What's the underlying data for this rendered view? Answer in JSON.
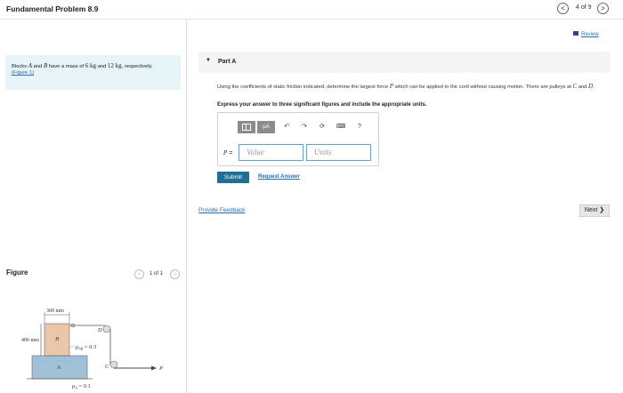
{
  "header": {
    "title": "Fundamental Problem 8.9",
    "page_count": "4 of 9",
    "prev_glyph": "<",
    "next_glyph": ">"
  },
  "problem": {
    "text_1": "Blocks ",
    "var_A": "A",
    "text_2": " and ",
    "var_B": "B",
    "text_3": " have a mass of ",
    "mass_A": "6 kg",
    "text_4": " and ",
    "mass_B": "12 kg",
    "text_5": ", respectively.",
    "figure_link": "(Figure 1)"
  },
  "figure_panel": {
    "title": "Figure",
    "count": "1 of 1",
    "prev_glyph": "<",
    "next_glyph": ">",
    "labels": {
      "width": "300 mm",
      "height": "400 mm",
      "block_A": "A",
      "block_B": "B",
      "pulley_C": "C",
      "pulley_D": "D",
      "force_P": "P",
      "mu_AB": "μ",
      "mu_AB_sub": "AB",
      "mu_AB_val": " = 0.3",
      "mu_A": "μ",
      "mu_A_sub": "A",
      "mu_A_val": " = 0.1"
    }
  },
  "review": {
    "label": "Review"
  },
  "part": {
    "caret": "▼",
    "title": "Part A",
    "question_1": "Using the coefficients of static friction indicated, determine the largest force ",
    "question_var": "P",
    "question_2": " which can be applied to the cord without causing motion. There are pulleys at ",
    "question_C": "C",
    "question_3": " and ",
    "question_D": "D",
    "question_4": ".",
    "instructions": "Express your answer to three significant figures and include the appropriate units."
  },
  "answer": {
    "toolbar": {
      "mu_label": "μA",
      "undo": "↶",
      "redo": "↷",
      "reset": "⟳",
      "keyboard": "⌨",
      "help": "?"
    },
    "variable": "P",
    "equals": " =",
    "value_placeholder": "Value",
    "units_placeholder": "Units"
  },
  "actions": {
    "submit": "Submit",
    "request_answer": "Request Answer",
    "provide_feedback": "Provide Feedback",
    "next": "Next ❯"
  },
  "colors": {
    "accent": "#1f6f96",
    "link": "#2b6ca3",
    "problem_bg": "#e6f3f7",
    "block_A": "#9fc0d6",
    "block_B": "#e9c7a8"
  },
  "icons": {
    "review": "review-icon",
    "undo": "undo-icon",
    "redo": "redo-icon",
    "reset": "reset-icon",
    "keyboard": "keyboard-icon",
    "help": "help-icon",
    "templates": "templates-icon"
  }
}
